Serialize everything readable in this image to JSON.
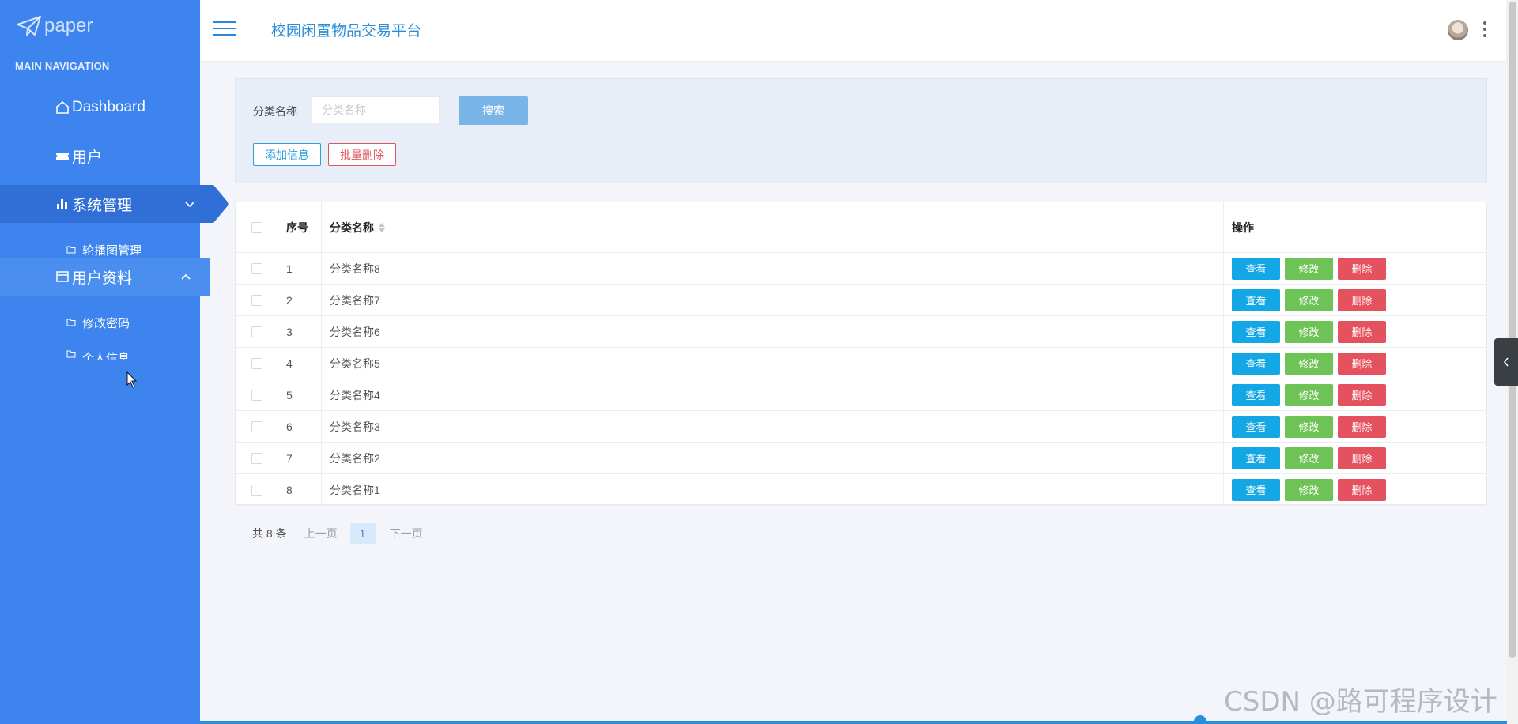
{
  "sidebar": {
    "logo_text": "paper",
    "nav_caption": "MAIN NAVIGATION",
    "items": {
      "dashboard": {
        "label": "Dashboard",
        "icon": "home-icon"
      },
      "users": {
        "label": "用户",
        "icon": "ticket-icon"
      },
      "system": {
        "label": "系统管理",
        "icon": "bar-chart-icon",
        "state": "active",
        "sub": [
          {
            "label": "轮播图管理",
            "icon": "folder-icon"
          }
        ]
      },
      "profile": {
        "label": "用户资料",
        "icon": "card-icon",
        "state": "expanded",
        "sub": [
          {
            "label": "修改密码",
            "icon": "folder-icon"
          },
          {
            "label": "个人信息",
            "icon": "folder-icon"
          }
        ]
      }
    }
  },
  "header": {
    "title": "校园闲置物品交易平台"
  },
  "search": {
    "label": "分类名称",
    "placeholder": "分类名称",
    "value": "",
    "search_button": "搜索",
    "add_button": "添加信息",
    "batch_delete_button": "批量删除"
  },
  "table": {
    "columns": {
      "index": "序号",
      "name": "分类名称",
      "ops": "操作"
    },
    "rows": [
      {
        "index": "1",
        "name": "分类名称8"
      },
      {
        "index": "2",
        "name": "分类名称7"
      },
      {
        "index": "3",
        "name": "分类名称6"
      },
      {
        "index": "4",
        "name": "分类名称5"
      },
      {
        "index": "5",
        "name": "分类名称4"
      },
      {
        "index": "6",
        "name": "分类名称3"
      },
      {
        "index": "7",
        "name": "分类名称2"
      },
      {
        "index": "8",
        "name": "分类名称1"
      }
    ],
    "actions": {
      "view": "查看",
      "edit": "修改",
      "delete": "删除"
    }
  },
  "pagination": {
    "total": "共 8 条",
    "prev": "上一页",
    "current_page": "1",
    "next": "下一页"
  },
  "watermark": "CSDN @路可程序设计",
  "colors": {
    "sidebar": "#3d84ee",
    "sidebar_active": "#2f6fd6",
    "accent": "#2a8fd8",
    "view": "#14a7e6",
    "edit": "#6dc356",
    "delete": "#e5525f"
  }
}
